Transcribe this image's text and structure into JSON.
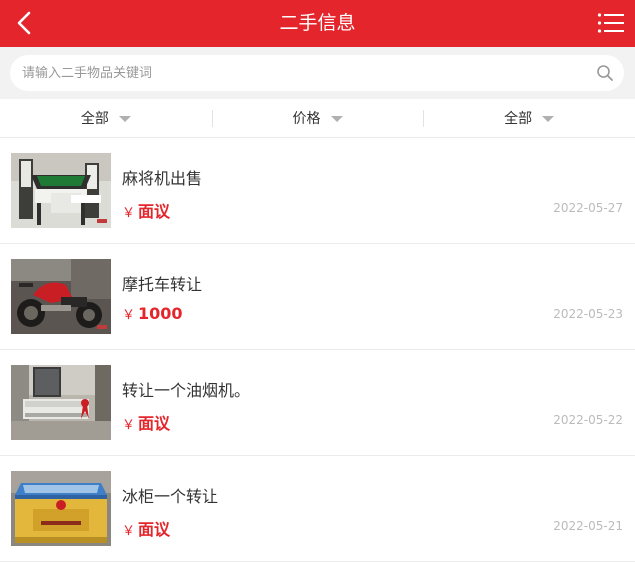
{
  "header": {
    "title": "二手信息",
    "back_icon": "back-chevron-icon",
    "menu_icon": "list-menu-icon",
    "background_color": "#e4262c"
  },
  "search": {
    "placeholder": "请输入二手物品关键词",
    "value": "",
    "icon": "search-icon"
  },
  "filters": [
    {
      "label": "全部"
    },
    {
      "label": "价格"
    },
    {
      "label": "全部"
    }
  ],
  "items": [
    {
      "title": "麻将机出售",
      "currency": "￥",
      "price": "面议",
      "date": "2022-05-27",
      "image": "mahjong-table-photo"
    },
    {
      "title": "摩托车转让",
      "currency": "￥",
      "price": "1000",
      "date": "2022-05-23",
      "image": "motorcycle-photo"
    },
    {
      "title": "转让一个油烟机。",
      "currency": "￥",
      "price": "面议",
      "date": "2022-05-22",
      "image": "range-hood-photo"
    },
    {
      "title": "冰柜一个转让",
      "currency": "￥",
      "price": "面议",
      "date": "2022-05-21",
      "image": "freezer-photo"
    }
  ],
  "colors": {
    "accent": "#e4262c",
    "price": "#e4262c",
    "date": "#bbbbbb"
  }
}
